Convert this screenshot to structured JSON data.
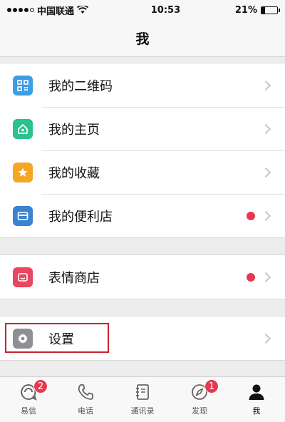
{
  "status_bar": {
    "carrier": "中国联通",
    "time": "10:53",
    "battery_percent": "21%",
    "battery_level": 0.21
  },
  "nav": {
    "title": "我"
  },
  "groups": [
    {
      "items": [
        {
          "label": "我的二维码",
          "icon": "qr-code-icon",
          "color": "#3d9ee3",
          "dot": false
        },
        {
          "label": "我的主页",
          "icon": "home-icon",
          "color": "#2ac28e",
          "dot": false
        },
        {
          "label": "我的收藏",
          "icon": "star-icon",
          "color": "#f5a623",
          "dot": false
        },
        {
          "label": "我的便利店",
          "icon": "card-icon",
          "color": "#3b82d1",
          "dot": true
        }
      ]
    },
    {
      "items": [
        {
          "label": "表情商店",
          "icon": "emoji-store-icon",
          "color": "#e8475f",
          "dot": true
        }
      ]
    },
    {
      "items": [
        {
          "label": "设置",
          "icon": "gear-icon",
          "color": "#8e8e93",
          "dot": false
        }
      ]
    }
  ],
  "tabs": [
    {
      "label": "易信",
      "icon": "chat-icon",
      "badge": "2"
    },
    {
      "label": "电话",
      "icon": "phone-icon",
      "badge": ""
    },
    {
      "label": "通讯录",
      "icon": "contacts-icon",
      "badge": ""
    },
    {
      "label": "发现",
      "icon": "compass-icon",
      "badge": "1"
    },
    {
      "label": "我",
      "icon": "person-icon",
      "badge": ""
    }
  ],
  "colors": {
    "badge": "#e8384f",
    "highlight": "#c5242f"
  }
}
